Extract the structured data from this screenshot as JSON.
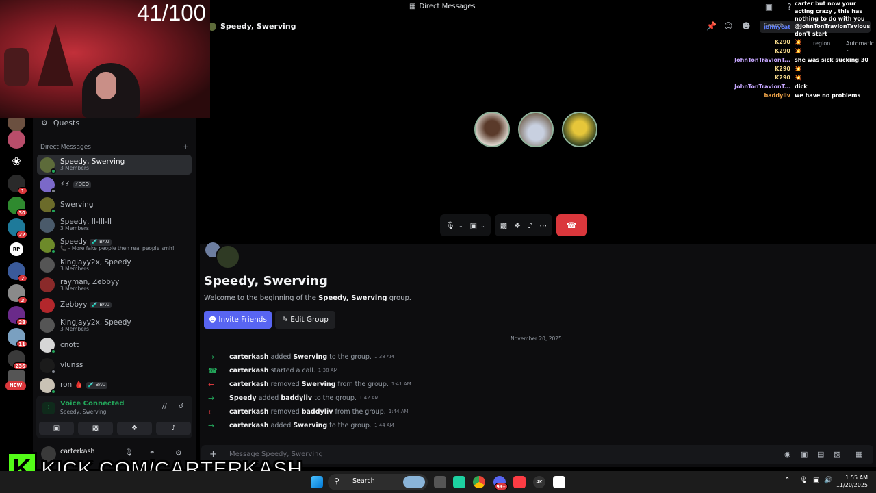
{
  "window": {
    "title": "Direct Messages"
  },
  "stream": {
    "counter": "41/100"
  },
  "sidebar": {
    "quests_label": "Quests",
    "dm_header": "Direct Messages",
    "dm_add": "+",
    "dms": [
      {
        "name": "Speedy, Swerving",
        "sub": "3 Members",
        "active": true,
        "color": "#5d6b3a",
        "status": "online"
      },
      {
        "name": "⚡⚡",
        "tag": "⚡DEO",
        "sub": "",
        "color": "#7b69c9",
        "status": "offline"
      },
      {
        "name": "Swerving",
        "sub": "",
        "color": "#6b6b2a",
        "status": "online"
      },
      {
        "name": "Speedy, II-III-II",
        "sub": "3 Members",
        "color": "#4a5a6a",
        "status": "none"
      },
      {
        "name": "Speedy",
        "tag": "🧪 BAU",
        "sub": "📞 - More fake people then real people smh!",
        "color": "#6d8a2a",
        "status": "online"
      },
      {
        "name": "Kingjayy2x, Speedy",
        "sub": "3 Members",
        "color": "#555",
        "status": "none"
      },
      {
        "name": "rayman, Zebbyy",
        "sub": "3 Members",
        "color": "#8a2a2a",
        "status": "none"
      },
      {
        "name": "Zebbyy",
        "tag": "🧪 BAU",
        "sub": "",
        "color": "#b3272c",
        "status": "none"
      },
      {
        "name": "Kingjayy2x, Speedy",
        "sub": "3 Members",
        "color": "#555",
        "status": "none"
      },
      {
        "name": "cnott",
        "sub": "",
        "color": "#d6d6d6",
        "status": "online"
      },
      {
        "name": "vlunss",
        "sub": "",
        "color": "#1b1b1b",
        "status": "offline"
      },
      {
        "name": "ron 🩸",
        "tag": "🧪 BAU",
        "sub": "",
        "color": "#c9c2b5",
        "status": "online"
      }
    ],
    "voice": {
      "status": "Voice Connected",
      "channel": "Speedy, Swerving"
    },
    "user": {
      "name": "carterkash"
    },
    "rail_badges": [
      "1",
      "30",
      "22",
      "7",
      "3",
      "28",
      "11",
      "236"
    ],
    "rail_new": "NEW"
  },
  "call": {
    "header_title": "Speedy, Swerving",
    "search_placeholder": "Search",
    "region_label": "region",
    "region_value": "Automatic"
  },
  "chat": {
    "group_name": "Speedy, Swerving",
    "welcome_prefix": "Welcome to the beginning of the ",
    "welcome_name": "Speedy, Swerving",
    "welcome_suffix": " group.",
    "invite_label": "Invite Friends",
    "edit_label": "Edit Group",
    "date_divider": "November 20, 2025",
    "events": [
      {
        "icon": "arrow-right",
        "actor": "carterkash",
        "verb": "added",
        "target": "Swerving",
        "tail": "to the group.",
        "time": "1:38 AM"
      },
      {
        "icon": "phone",
        "actor": "carterkash",
        "verb": "started a call.",
        "target": "",
        "tail": "",
        "time": "1:38 AM"
      },
      {
        "icon": "arrow-left",
        "actor": "carterkash",
        "verb": "removed",
        "target": "Swerving",
        "tail": "from the group.",
        "time": "1:41 AM"
      },
      {
        "icon": "arrow-right",
        "actor": "Speedy",
        "verb": "added",
        "target": "baddyliv",
        "tail": "to the group.",
        "time": "1:42 AM"
      },
      {
        "icon": "arrow-left",
        "actor": "carterkash",
        "verb": "removed",
        "target": "baddyliv",
        "tail": "from the group.",
        "time": "1:44 AM"
      },
      {
        "icon": "arrow-right",
        "actor": "carterkash",
        "verb": "added",
        "target": "Swerving",
        "tail": "to the group.",
        "time": "1:44 AM"
      }
    ],
    "composer_placeholder": "Message Speedy, Swerving"
  },
  "overlay_chat": [
    {
      "user": "",
      "msg": "carter but now your acting crazy , this has nothing to do with you",
      "color": "#ffffff"
    },
    {
      "user": "jonnycat",
      "msg": "@JohnTonTravionTavious don't start",
      "color": "#5c7cfa"
    },
    {
      "user": "K290",
      "msg": "💥",
      "color": "#f5d98b"
    },
    {
      "user": "K290",
      "msg": "💥",
      "color": "#f5d98b"
    },
    {
      "user": "JohnTonTravionT...",
      "msg": "she was sick sucking 30",
      "color": "#c6a7ff"
    },
    {
      "user": "K290",
      "msg": "💥",
      "color": "#f5d98b"
    },
    {
      "user": "K290",
      "msg": "💥",
      "color": "#f5d98b"
    },
    {
      "user": "JohnTonTravionT...",
      "msg": "dick",
      "color": "#c6a7ff"
    },
    {
      "user": "baddyliv",
      "msg": "we have no problems",
      "color": "#f0a54a"
    }
  ],
  "banner": {
    "logo": "K",
    "url": "KICK.COM/CARTERKASH"
  },
  "taskbar": {
    "search_label": "Search",
    "time": "1:55 AM",
    "date": "11/20/2025",
    "discord_badge": "99+"
  }
}
